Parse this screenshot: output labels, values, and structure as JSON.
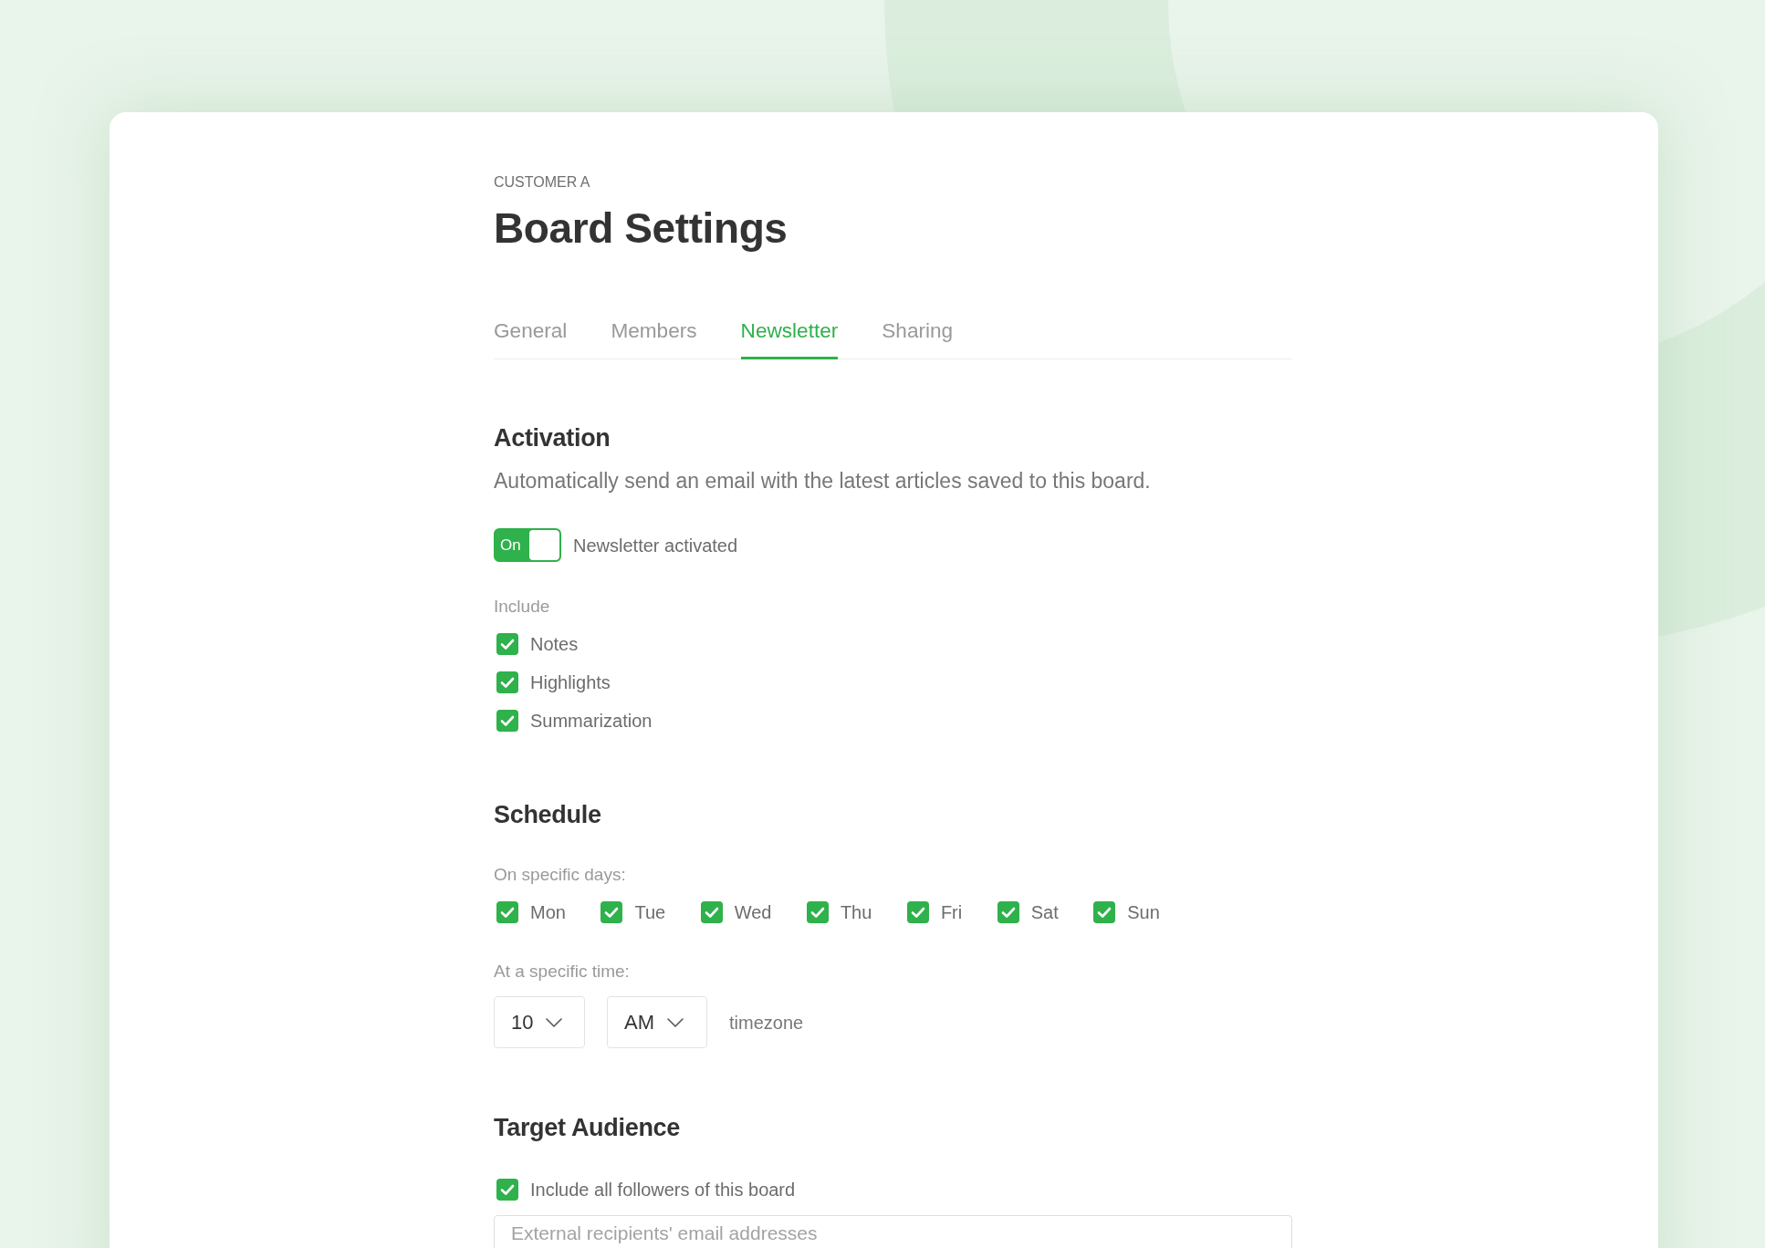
{
  "header": {
    "eyebrow": "CUSTOMER A",
    "title": "Board Settings"
  },
  "tabs": [
    {
      "label": "General",
      "selected": false
    },
    {
      "label": "Members",
      "selected": false
    },
    {
      "label": "Newsletter",
      "selected": true
    },
    {
      "label": "Sharing",
      "selected": false
    }
  ],
  "activation": {
    "heading": "Activation",
    "description": "Automatically send an email with the latest articles saved to this board.",
    "toggle": {
      "text": "On",
      "on": true,
      "label": "Newsletter activated"
    },
    "include": {
      "label": "Include",
      "options": [
        {
          "label": "Notes",
          "checked": true
        },
        {
          "label": "Highlights",
          "checked": true
        },
        {
          "label": "Summarization",
          "checked": true
        }
      ]
    }
  },
  "schedule": {
    "heading": "Schedule",
    "days": {
      "label": "On specific days:",
      "options": [
        {
          "label": "Mon",
          "checked": true
        },
        {
          "label": "Tue",
          "checked": true
        },
        {
          "label": "Wed",
          "checked": true
        },
        {
          "label": "Thu",
          "checked": true
        },
        {
          "label": "Fri",
          "checked": true
        },
        {
          "label": "Sat",
          "checked": true
        },
        {
          "label": "Sun",
          "checked": true
        }
      ]
    },
    "time": {
      "label": "At a specific time:",
      "hour": "10",
      "period": "AM",
      "timezone": "timezone"
    }
  },
  "target_audience": {
    "heading": "Target Audience",
    "followers": {
      "label": "Include all followers of this board",
      "checked": true
    },
    "recipients": {
      "placeholder": "External recipients' email addresses"
    }
  }
}
